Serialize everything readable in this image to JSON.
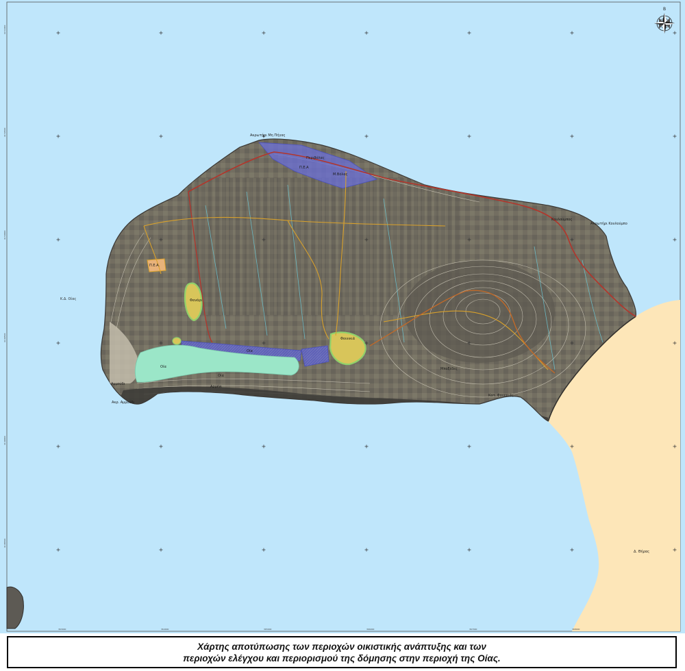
{
  "map": {
    "colors": {
      "sea": "#bfe6fb",
      "mainland": "#fde6b8",
      "terrain": "#6f6a5e",
      "cliffs": "#3b3936",
      "settlement_green": "#9be6c8",
      "control_zone_blue": "#6a6fd8",
      "village_core": "#d8c55a",
      "road_main": "#b3352b",
      "road_secondary": "#d9a12b",
      "contour": "#d9d4c4",
      "stream": "#6cc2cf"
    },
    "compass": {
      "north_label": "Β",
      "icon": "compass-rose-icon"
    },
    "labels": {
      "sea_west": "Κ.Δ. Οίας",
      "mainland": "Δ. Θήρας",
      "cape_north": "Ακρωτήρι Μη Πήγας",
      "north_zone": "Περιβόλας",
      "north_zone_code": "Π.Ε.Α",
      "north_zone_sub": "Μ.Βόλας",
      "cape_east": "Ακρωτήρι Κουλούμπο",
      "east_place": "Κουλούμπος",
      "village_west": "Φανάρι",
      "village_center": "Φοινικιά",
      "oia": "Οία",
      "zone_south": "Οία",
      "oia_center": "Οία",
      "port_ammoudi": "Αμμούδι",
      "cape_ammoudi": "Ακρ. Αμμούδι",
      "coast_armeni": "Αρμένι",
      "coast_east": "Κατ. Φοινικιάς",
      "place_south": "Μπαξέδες",
      "zone_f": "Π.Ε.Α."
    },
    "ticks": {
      "bottom": [
        "363000",
        "364000",
        "365000",
        "366000",
        "367000",
        "368000"
      ],
      "left": [
        "4151000",
        "4150500",
        "4150000",
        "4149500",
        "4149000",
        "4148500"
      ]
    }
  },
  "title": {
    "line1": "Χάρτης αποτύπωσης των περιοχών οικιστικής ανάπτυξης και των",
    "line2": "περιοχών ελέγχου και περιορισμού της δόμησης στην περιοχή της Οίας."
  }
}
